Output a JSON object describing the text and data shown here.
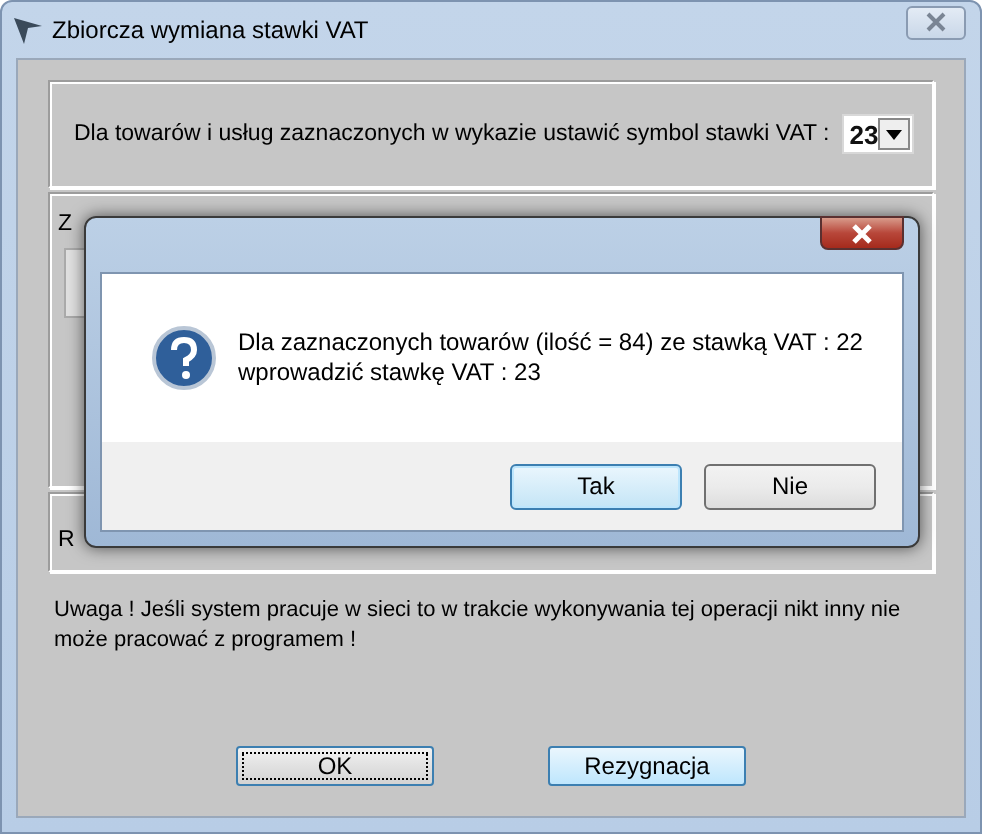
{
  "window": {
    "title": "Zbiorcza wymiana stawki VAT"
  },
  "vat_symbol": {
    "label": "Dla towarów i usług zaznaczonych w wykazie ustawić symbol stawki VAT :",
    "value": "23"
  },
  "section_2_label": "Z",
  "section_3_label": "R",
  "warning": "Uwaga ! Jeśli system pracuje w sieci to w trakcie wykonywania tej operacji nikt inny nie może pracować z programem !",
  "buttons": [
    {
      "label": "OK",
      "focused": true
    },
    {
      "label": "Rezygnacja",
      "focused": false
    }
  ],
  "dialog": {
    "message": [
      "Dla zaznaczonych towarów (ilość = 84) ze stawką VAT : 22",
      "wprowadzić stawkę VAT : 23"
    ],
    "buttons": [
      {
        "label": "Tak",
        "focused": true
      },
      {
        "label": "Nie",
        "focused": false
      }
    ]
  }
}
